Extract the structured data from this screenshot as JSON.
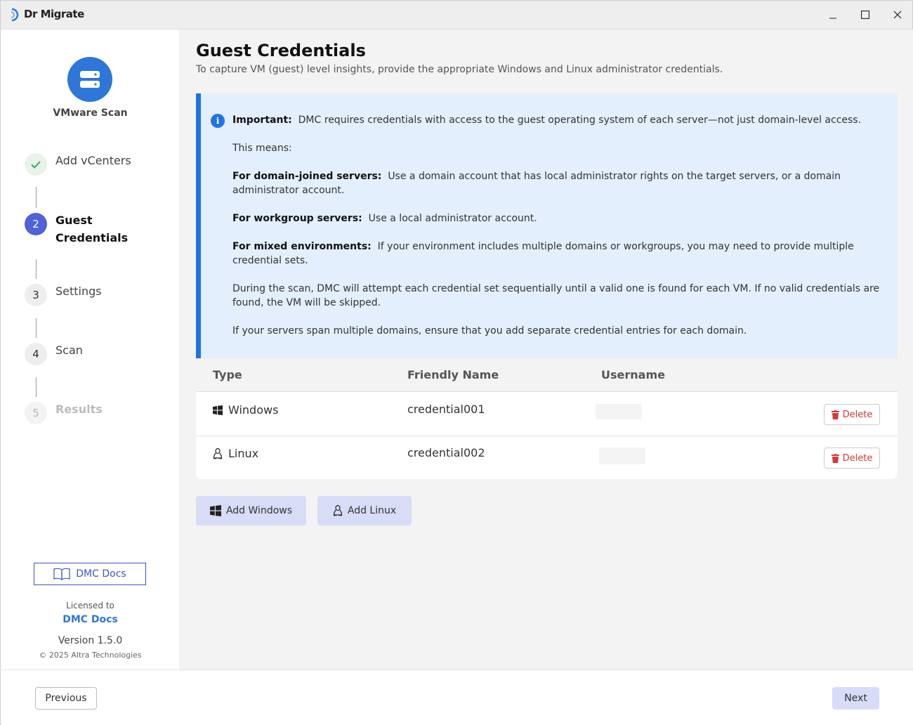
{
  "app": {
    "title": "Dr Migrate",
    "accent": "#2f76d9"
  },
  "window_controls": {
    "minimize": "minimize-icon",
    "maximize": "maximize-icon",
    "close": "close-icon"
  },
  "sidebar": {
    "scan_icon": "server-icon",
    "scan_label": "VMware Scan",
    "steps": [
      {
        "marker": "✓",
        "label": "Add vCenters",
        "state": "done"
      },
      {
        "marker": "2",
        "label": "Guest Credentials",
        "state": "active"
      },
      {
        "marker": "3",
        "label": "Settings",
        "state": "pending"
      },
      {
        "marker": "4",
        "label": "Scan",
        "state": "pending"
      },
      {
        "marker": "5",
        "label": "Results",
        "state": "disabled"
      }
    ],
    "docs_button": "DMC Docs",
    "licensed_to_label": "Licensed to",
    "licensee": "DMC Docs",
    "version": "Version 1.5.0",
    "copyright": "© 2025 Altra Technologies"
  },
  "main": {
    "title": "Guest Credentials",
    "subtitle": "To capture VM (guest) level insights, provide the appropriate Windows and Linux administrator credentials.",
    "info": {
      "important_label": "Important:",
      "important_text": "DMC requires credentials with access to the guest operating system of each server—not just domain-level access.",
      "means": "This means:",
      "domain_label": "For domain-joined servers:",
      "domain_text": "Use a domain account that has local administrator rights on the target servers, or a domain administrator account.",
      "workgroup_label": "For workgroup servers:",
      "workgroup_text": "Use a local administrator account.",
      "mixed_label": "For mixed environments:",
      "mixed_text": "If your environment includes multiple domains or workgroups, you may need to provide multiple credential sets.",
      "during_scan": "During the scan, DMC will attempt each credential set sequentially until a valid one is found for each VM. If no valid credentials are found, the VM will be skipped.",
      "span": "If your servers span multiple domains, ensure that you add separate credential entries for each domain."
    },
    "table": {
      "headers": [
        "Type",
        "Friendly Name",
        "Username"
      ],
      "rows": [
        {
          "type": "Windows",
          "type_icon": "windows-icon",
          "friendly_name": "credential001",
          "delete": "Delete"
        },
        {
          "type": "Linux",
          "type_icon": "linux-icon",
          "friendly_name": "credential002",
          "delete": "Delete"
        }
      ]
    },
    "add_windows": "Add Windows",
    "add_linux": "Add Linux"
  },
  "footer": {
    "previous": "Previous",
    "next": "Next"
  }
}
